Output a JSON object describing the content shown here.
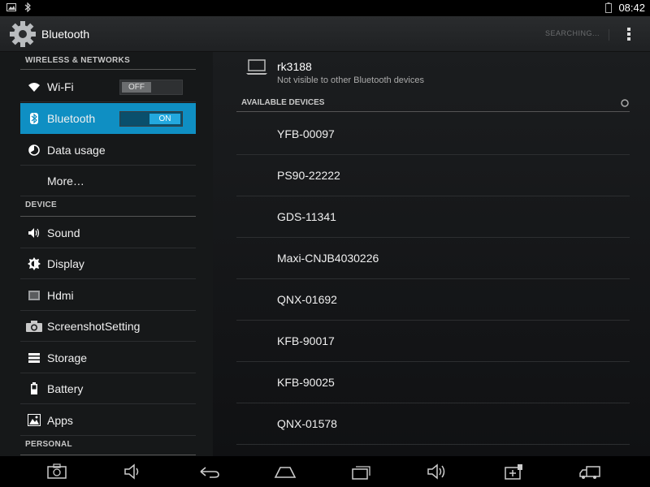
{
  "status_bar": {
    "time": "08:42"
  },
  "action_bar": {
    "title": "Bluetooth",
    "searching": "SEARCHING..."
  },
  "left_panel": {
    "sections": {
      "wireless": "WIRELESS & NETWORKS",
      "device": "DEVICE",
      "personal": "PERSONAL"
    },
    "items": [
      {
        "label": "Wi-Fi",
        "icon": "wifi-icon",
        "toggle": "OFF"
      },
      {
        "label": "Bluetooth",
        "icon": "bluetooth-icon",
        "toggle": "ON",
        "active": true
      },
      {
        "label": "Data usage",
        "icon": "data-usage-icon"
      },
      {
        "label": "More…"
      },
      {
        "label": "Sound",
        "icon": "sound-icon"
      },
      {
        "label": "Display",
        "icon": "display-icon"
      },
      {
        "label": "Hdmi",
        "icon": "hdmi-icon"
      },
      {
        "label": "ScreenshotSetting",
        "icon": "camera-icon"
      },
      {
        "label": "Storage",
        "icon": "storage-icon"
      },
      {
        "label": "Battery",
        "icon": "battery-icon"
      },
      {
        "label": "Apps",
        "icon": "apps-icon"
      }
    ]
  },
  "local_device": {
    "name": "rk3188",
    "status": "Not visible to other Bluetooth devices"
  },
  "available": {
    "header": "AVAILABLE DEVICES",
    "devices": [
      "YFB-00097",
      "PS90-22222",
      "GDS-11341",
      "Maxi-CNJB4030226",
      "QNX-01692",
      "KFB-90017",
      "KFB-90025",
      "QNX-01578"
    ]
  },
  "colors": {
    "accent": "#0f8fc3",
    "toggle_on": "#23a8de"
  }
}
